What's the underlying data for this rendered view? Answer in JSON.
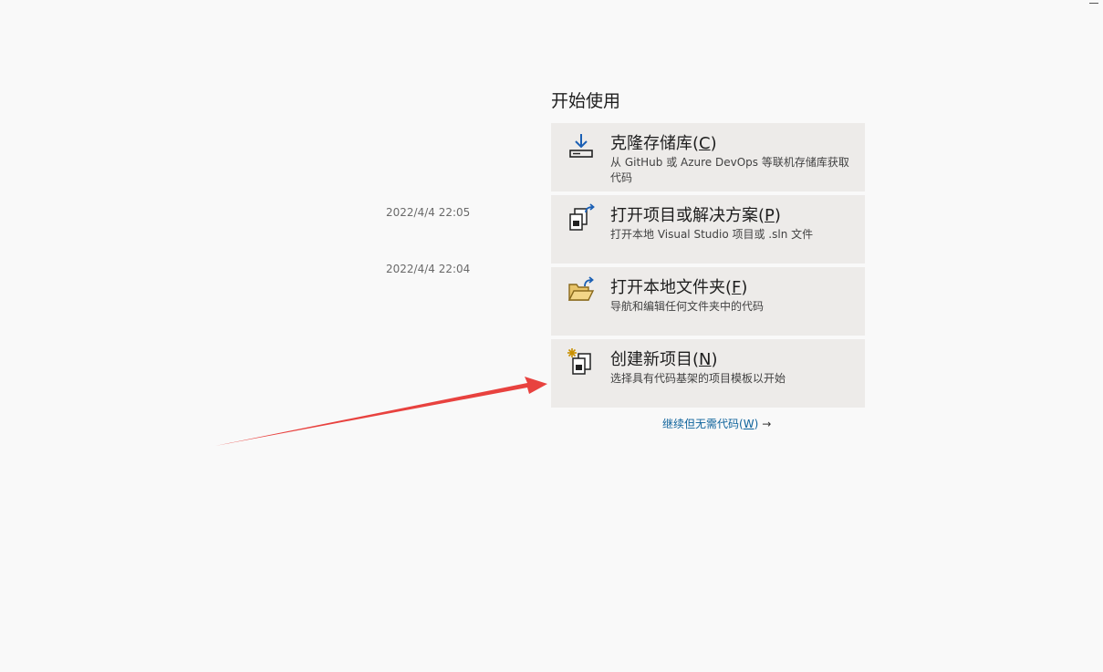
{
  "start": {
    "title": "开始使用"
  },
  "recent": {
    "items": [
      {
        "date": "2022/4/4 22:05"
      },
      {
        "date": "2022/4/4 22:04"
      }
    ]
  },
  "actions": [
    {
      "title_prefix": "克隆存储库(",
      "accelerator": "C",
      "title_suffix": ")",
      "description": "从 GitHub 或 Azure DevOps 等联机存储库获取代码",
      "icon": "clone-download-icon"
    },
    {
      "title_prefix": "打开项目或解决方案(",
      "accelerator": "P",
      "title_suffix": ")",
      "description": "打开本地 Visual Studio 项目或 .sln 文件",
      "icon": "open-project-icon"
    },
    {
      "title_prefix": "打开本地文件夹(",
      "accelerator": "F",
      "title_suffix": ")",
      "description": "导航和编辑任何文件夹中的代码",
      "icon": "open-folder-icon"
    },
    {
      "title_prefix": "创建新项目(",
      "accelerator": "N",
      "title_suffix": ")",
      "description": "选择具有代码基架的项目模板以开始",
      "icon": "new-project-icon"
    }
  ],
  "continue": {
    "label_prefix": "继续但无需代码(",
    "accelerator": "W",
    "label_suffix": ")",
    "arrow": "→"
  },
  "colors": {
    "background": "#f9f9f9",
    "card_background": "#edebe9",
    "link": "#0e639c",
    "annotation_arrow": "#e8423f"
  }
}
